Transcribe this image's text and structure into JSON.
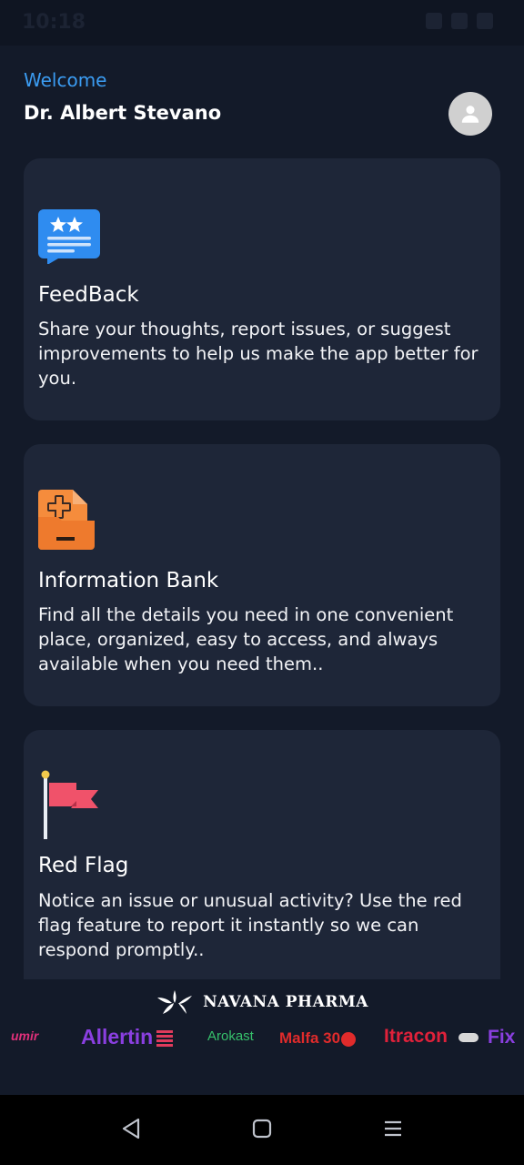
{
  "status": {
    "time": "10:18"
  },
  "header": {
    "welcome": "Welcome",
    "doctor_name": "Dr. Albert Stevano"
  },
  "cards": [
    {
      "title": "FeedBack",
      "description": "Share your thoughts, report issues, or suggest improvements to help us make the app better for you.",
      "icon": "feedback-icon"
    },
    {
      "title": "Information Bank",
      "description": "Find all the details you need in one convenient place, organized, easy to access, and always available when you need them..",
      "icon": "medical-folder-icon"
    },
    {
      "title": "Red Flag",
      "description": "Notice an issue or unusual activity? Use the red flag feature to report it instantly so we can respond promptly..",
      "icon": "red-flag-icon"
    }
  ],
  "brand": {
    "company": "NAVANA PHARMA",
    "products": [
      "umir",
      "Allertin",
      "Arokast",
      "Malfa 30",
      "Itracon",
      "Fix"
    ]
  },
  "colors": {
    "accent": "#3b9cf2",
    "card_bg": "#1e2638",
    "page_bg": "#131a29"
  }
}
